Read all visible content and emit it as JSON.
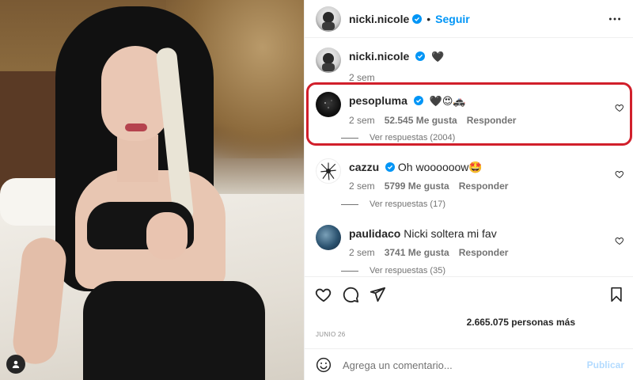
{
  "post": {
    "author": "nicki.nicole",
    "follow_label": "Seguir",
    "separator": "•",
    "more_icon": "more-horizontal-icon",
    "user_tag_icon": "user-tag-icon"
  },
  "caption": {
    "username": "nicki.nicole",
    "text": "🖤",
    "time": "2 sem"
  },
  "comments": [
    {
      "username": "pesopluma",
      "verified": true,
      "text": "🖤😍🚓",
      "time": "2 sem",
      "likes": "52.545 Me gusta",
      "reply": "Responder",
      "replies": "Ver respuestas (2004)"
    },
    {
      "username": "cazzu",
      "verified": true,
      "text": "Oh woooooow🤩",
      "time": "2 sem",
      "likes": "5799 Me gusta",
      "reply": "Responder",
      "replies": "Ver respuestas (17)"
    },
    {
      "username": "paulidaco",
      "verified": false,
      "text": "Nicki soltera mi fav",
      "time": "2 sem",
      "likes": "3741 Me gusta",
      "reply": "Responder",
      "replies": "Ver respuestas (35)"
    }
  ],
  "actions": {
    "likes": "2.665.075 personas más",
    "date": "JUNIO 26",
    "icons": [
      "heart-icon",
      "comment-icon",
      "share-icon",
      "bookmark-icon"
    ]
  },
  "composer": {
    "placeholder": "Agrega un comentario...",
    "publish": "Publicar"
  },
  "colors": {
    "accent": "#0095f6",
    "verified": "#0095f6",
    "highlight": "#d11f2b",
    "publish_disabled": "#b3dbff"
  }
}
